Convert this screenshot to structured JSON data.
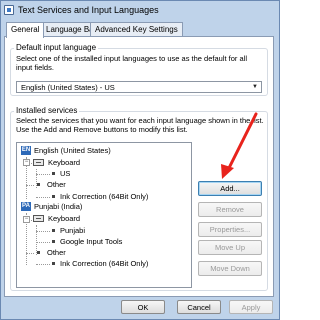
{
  "window": {
    "title": "Text Services and Input Languages"
  },
  "tabs": [
    {
      "label": "General",
      "active": true
    },
    {
      "label": "Language Bar",
      "active": false
    },
    {
      "label": "Advanced Key Settings",
      "active": false
    }
  ],
  "default_language": {
    "group_label": "Default input language",
    "description": "Select one of the installed input languages to use as the default for all input fields.",
    "selected": "English (United States) - US"
  },
  "installed_services": {
    "group_label": "Installed services",
    "description": "Select the services that you want for each input language shown in the list. Use the Add and Remove buttons to modify this list.",
    "tree": [
      {
        "badge": "EN",
        "language": "English (United States)",
        "categories": [
          {
            "label": "Keyboard",
            "items": [
              "US"
            ]
          },
          {
            "label": "Other",
            "items": [
              "Ink Correction (64Bit Only)"
            ]
          }
        ]
      },
      {
        "badge": "PA",
        "language": "Punjabi (India)",
        "categories": [
          {
            "label": "Keyboard",
            "items": [
              "Punjabi",
              "Google Input Tools"
            ]
          },
          {
            "label": "Other",
            "items": [
              "Ink Correction (64Bit Only)"
            ]
          }
        ]
      }
    ],
    "buttons": {
      "add": "Add...",
      "remove": "Remove",
      "properties": "Properties...",
      "move_up": "Move Up",
      "move_down": "Move Down"
    }
  },
  "footer": {
    "ok": "OK",
    "cancel": "Cancel",
    "apply": "Apply"
  },
  "colors": {
    "annotation_arrow": "#e8231c",
    "window_frame": "#bfd3ea"
  },
  "icons": [
    "app-icon",
    "language-badge-icon",
    "keyboard-icon",
    "expander-icon",
    "dropdown-arrow-icon",
    "annotation-arrow"
  ]
}
